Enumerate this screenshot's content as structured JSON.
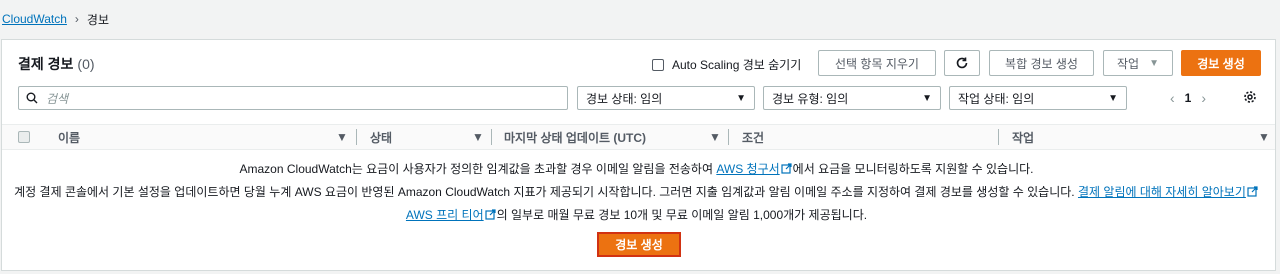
{
  "breadcrumb": {
    "root": "CloudWatch",
    "current": "경보"
  },
  "panel": {
    "title": "결제 경보",
    "count": "(0)",
    "auto_scaling_label": "Auto Scaling 경보 숨기기",
    "clear_selection": "선택 항목 지우기",
    "composite_alarm": "복합 경보 생성",
    "actions": "작업",
    "create_alarm": "경보 생성"
  },
  "filters": {
    "search_placeholder": "검색",
    "alarm_state": "경보 상태: 임의",
    "alarm_type": "경보 유형: 임의",
    "action_state": "작업 상태: 임의"
  },
  "pager": {
    "page": "1"
  },
  "table": {
    "columns": [
      "이름",
      "상태",
      "마지막 상태 업데이트 (UTC)",
      "조건",
      "작업"
    ]
  },
  "empty_state": {
    "line1_pre": "Amazon CloudWatch는 요금이 사용자가 정의한 임계값을 초과할 경우 이메일 알림을 전송하여",
    "line1_link": "AWS 청구서",
    "line1_post": "에서 요금을 모니터링하도록 지원할 수 있습니다.",
    "line2_pre": "계정 결제 콘솔에서 기본 설정을 업데이트하면 당월 누계 AWS 요금이 반영된 Amazon CloudWatch 지표가 제공되기 시작합니다. 그러면 지출 임계값과 알림 이메일 주소를 지정하여 결제 경보를 생성할 수 있습니다.",
    "line2_link": "결제 알림에 대해 자세히 알아보기",
    "line3_link": "AWS 프리 티어",
    "line3_post": "의 일부로 매월 무료 경보 10개 및 무료 이메일 알림 1,000개가 제공됩니다.",
    "create_button": "경보 생성"
  },
  "colors": {
    "accent": "#ec7211",
    "link": "#0073bb",
    "highlight_border": "#d13212"
  }
}
